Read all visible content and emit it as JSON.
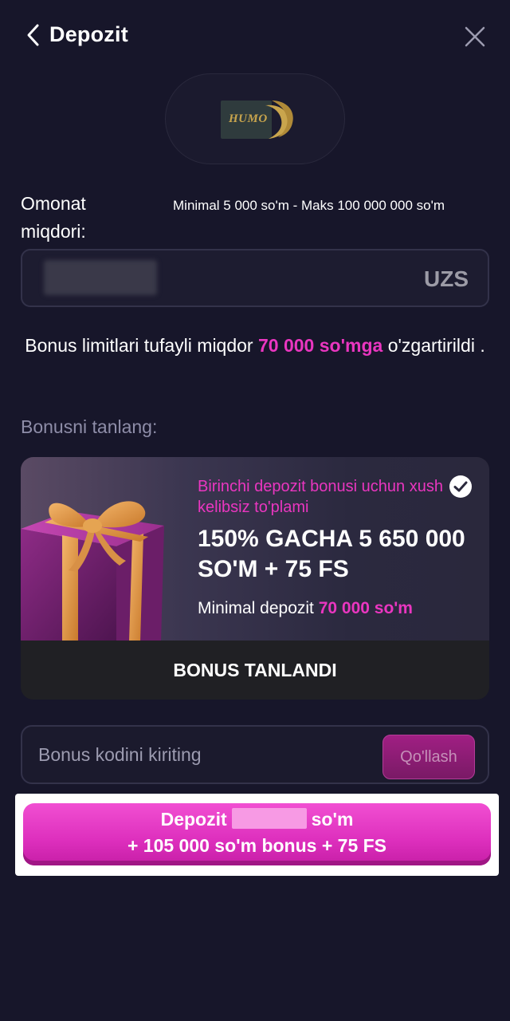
{
  "header": {
    "title": "Depozit"
  },
  "payment_method": {
    "logo_text": "HUMO"
  },
  "amount": {
    "label": "Omonat miqdori:",
    "limits": "Minimal 5 000 so'm - Maks 100 000 000 so'm",
    "currency": "UZS"
  },
  "notice": {
    "prefix": "Bonus limitlari tufayli miqdor ",
    "highlight": "70 000 so'mga",
    "suffix": " o'zgartirildi ."
  },
  "bonus": {
    "heading": "Bonusni tanlang:",
    "subtitle": "Birinchi depozit bonusi uchun xush kelibsiz to'plami",
    "title": "150% GACHA 5 650 000 SO'M + 75 FS",
    "min_label": "Minimal depozit ",
    "min_value": "70 000 so'm",
    "selected_label": "BONUS TANLANDI"
  },
  "promo": {
    "placeholder": "Bonus kodini kiriting",
    "apply_label": "Qo'llash"
  },
  "deposit_button": {
    "prefix": "Depozit",
    "suffix": "so'm",
    "line2": "+ 105 000 so'm bonus + 75 FS"
  },
  "colors": {
    "background": "#17162a",
    "accent": "#ea36c0"
  }
}
